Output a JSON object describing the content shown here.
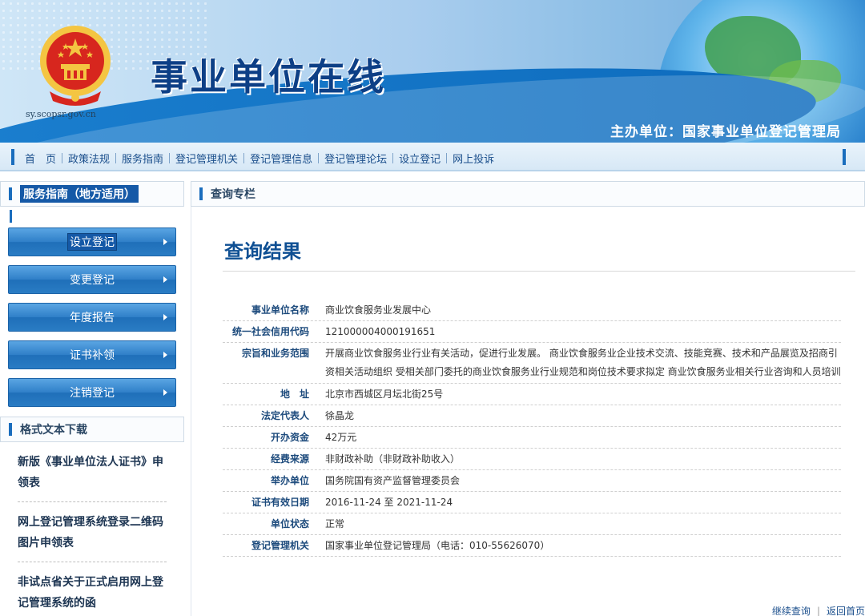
{
  "banner": {
    "emblem_url": "sy.scopsr.gov.cn",
    "site_title": "事业单位在线",
    "sponsor": "主办单位：国家事业单位登记管理局"
  },
  "nav": {
    "items": [
      "首　页",
      "政策法规",
      "服务指南",
      "登记管理机关",
      "登记管理信息",
      "登记管理论坛",
      "设立登记",
      "网上投诉"
    ]
  },
  "sidebar": {
    "service_title": "服务指南（地方适用）",
    "buttons": [
      "设立登记",
      "变更登记",
      "年度报告",
      "证书补领",
      "注销登记"
    ],
    "download_title": "格式文本下载",
    "downloads": [
      "新版《事业单位法人证书》申领表",
      "网上登记管理系统登录二维码图片申领表",
      "非试点省关于正式启用网上登记管理系统的函"
    ]
  },
  "main": {
    "panel_title": "查询专栏",
    "result_title": "查询结果",
    "fields": [
      {
        "label": "事业单位名称",
        "value": "商业饮食服务业发展中心"
      },
      {
        "label": "统一社会信用代码",
        "value": "121000004000191651"
      },
      {
        "label": "宗旨和业务范围",
        "value": "开展商业饮食服务业行业有关活动，促进行业发展。 商业饮食服务业企业技术交流、技能竞赛、技术和产品展览及招商引资相关活动组织 受相关部门委托的商业饮食服务业行业规范和岗位技术要求拟定 商业饮食服务业相关行业咨询和人员培训"
      },
      {
        "label": "地　址",
        "value": "北京市西城区月坛北街25号"
      },
      {
        "label": "法定代表人",
        "value": "徐晶龙"
      },
      {
        "label": "开办资金",
        "value": "42万元"
      },
      {
        "label": "经费来源",
        "value": "非财政补助（非财政补助收入）"
      },
      {
        "label": "举办单位",
        "value": "国务院国有资产监督管理委员会"
      },
      {
        "label": "证书有效日期",
        "value": "2016-11-24 至 2021-11-24"
      },
      {
        "label": "单位状态",
        "value": "正常"
      },
      {
        "label": "登记管理机关",
        "value": "国家事业单位登记管理局（电话：010-55626070）"
      }
    ],
    "links": {
      "continue": "继续查询",
      "home": "返回首页"
    }
  },
  "colors": {
    "brand_blue": "#1a6dbd",
    "title_blue": "#0d3f86",
    "emblem_red": "#d7261e",
    "emblem_gold": "#f4c542"
  },
  "icons": {
    "emblem": "national-emblem-icon",
    "arrow": "chevron-right-icon"
  }
}
